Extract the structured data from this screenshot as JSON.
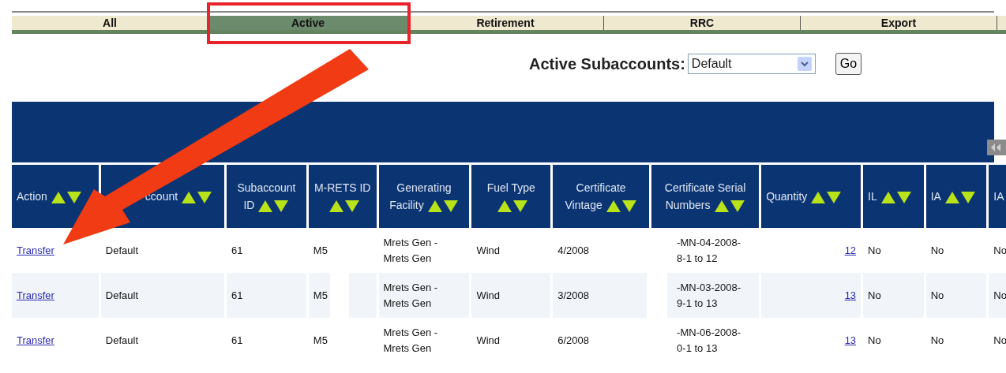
{
  "tabs": [
    {
      "label": "All",
      "selected": false
    },
    {
      "label": "Active",
      "selected": true
    },
    {
      "label": "Retirement",
      "selected": false
    },
    {
      "label": "RRC",
      "selected": false
    },
    {
      "label": "Export",
      "selected": false
    }
  ],
  "subaccount_filter": {
    "label": "Active Subaccounts:",
    "value": "Default",
    "button": "Go"
  },
  "table": {
    "columns": [
      {
        "label": "Action"
      },
      {
        "label": "ccount"
      },
      {
        "label": "Subaccount ID"
      },
      {
        "label": "M-RETS ID"
      },
      {
        "label": "Generating Facility"
      },
      {
        "label": "Fuel Type"
      },
      {
        "label": "Certificate Vintage"
      },
      {
        "label": "Certificate Serial Numbers"
      },
      {
        "label": "Quantity"
      },
      {
        "label": "IL"
      },
      {
        "label": "IA"
      },
      {
        "label": "IA"
      }
    ],
    "rows": [
      {
        "cells": [
          "Transfer",
          "Default",
          "61",
          "M5",
          "Mrets Gen - Mrets Gen",
          "Wind",
          "4/2008",
          [
            "-MN-04-2008-",
            "8-1 to 12"
          ],
          "12",
          "No",
          "No",
          "No"
        ]
      },
      {
        "cells": [
          "Transfer",
          "Default",
          "61",
          "M5",
          "Mrets Gen - Mrets Gen",
          "Wind",
          "3/2008",
          [
            "-MN-03-2008-",
            "9-1 to 13"
          ],
          "13",
          "No",
          "No",
          "No"
        ]
      },
      {
        "cells": [
          "Transfer",
          "Default",
          "61",
          "M5",
          "Mrets Gen - Mrets Gen",
          "Wind",
          "6/2008",
          [
            "-MN-06-2008-",
            "0-1 to 13"
          ],
          "13",
          "No",
          "No",
          "No"
        ]
      }
    ]
  }
}
